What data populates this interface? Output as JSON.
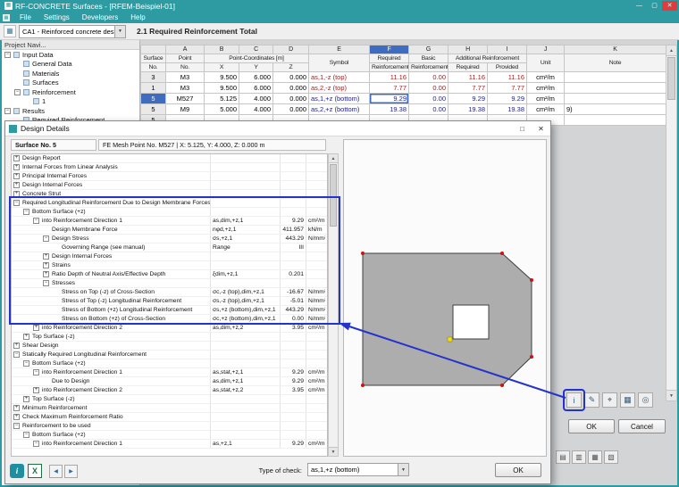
{
  "window": {
    "title": "RF-CONCRETE Surfaces - [RFEM-Beispiel-01]"
  },
  "menubar": {
    "items": [
      "File",
      "Settings",
      "Developers",
      "Help"
    ]
  },
  "toolbar": {
    "case_selector": "CA1 - Reinforced concrete desi",
    "table_title": "2.1 Required Reinforcement Total"
  },
  "icons": {
    "app": "▦",
    "menu_icon": "▦",
    "toolbar_table": "▦",
    "minimize": "—",
    "maximize": "▢",
    "close": "✕",
    "dropdown": "▼",
    "scroll_up": "▲",
    "scroll_down": "▼",
    "dialog_maximize": "□",
    "dialog_close": "✕",
    "info": "i",
    "excel": "X",
    "nav_prev": "◀",
    "nav_next": "▶"
  },
  "navigator": {
    "caption": "Project Navi...",
    "items": [
      {
        "label": "Input Data",
        "indent": 0,
        "expander": "minus"
      },
      {
        "label": "General Data",
        "indent": 1,
        "expander": "none"
      },
      {
        "label": "Materials",
        "indent": 1,
        "expander": "none"
      },
      {
        "label": "Surfaces",
        "indent": 1,
        "expander": "none"
      },
      {
        "label": "Reinforcement",
        "indent": 1,
        "expander": "minus"
      },
      {
        "label": "1",
        "indent": 2,
        "expander": "none"
      },
      {
        "label": "Results",
        "indent": 0,
        "expander": "minus"
      },
      {
        "label": "Required Reinforcement",
        "indent": 1,
        "expander": "none"
      }
    ]
  },
  "table": {
    "letters": [
      "",
      "A",
      "B",
      "C",
      "D",
      "E",
      "F",
      "G",
      "H",
      "I",
      "J",
      "K"
    ],
    "selected_letter": "F",
    "headers": {
      "surface": [
        "Surface",
        "No."
      ],
      "point": [
        "Point",
        "No."
      ],
      "coords_group": "Point-Coordinates [m]",
      "coords": [
        "X",
        "Y",
        "Z"
      ],
      "symbol": "Symbol",
      "required": [
        "Required",
        "Reinforcement"
      ],
      "basic": [
        "Basic",
        "Reinforcement"
      ],
      "additional_group": "Additional Reinforcement",
      "additional": [
        "Required",
        "Provided"
      ],
      "unit": "Unit",
      "note": "Note"
    },
    "rows": [
      {
        "surface": "3",
        "point": "M3",
        "x": "9.500",
        "y": "6.000",
        "z": "0.000",
        "symbol": "as,1,-z (top)",
        "required": "11.16",
        "basic": "0.00",
        "add_required": "11.16",
        "provided": "11.16",
        "unit": "cm²/m",
        "note": "",
        "side": "top",
        "selected": false
      },
      {
        "surface": "1",
        "point": "M3",
        "x": "9.500",
        "y": "6.000",
        "z": "0.000",
        "symbol": "as,2,-z (top)",
        "required": "7.77",
        "basic": "0.00",
        "add_required": "7.77",
        "provided": "7.77",
        "unit": "cm²/m",
        "note": "",
        "side": "top",
        "selected": false
      },
      {
        "surface": "5",
        "point": "M527",
        "x": "5.125",
        "y": "4.000",
        "z": "0.000",
        "symbol": "as,1,+z (bottom)",
        "required": "9.29",
        "basic": "0.00",
        "add_required": "9.29",
        "provided": "9.29",
        "unit": "cm²/m",
        "note": "",
        "side": "bottom",
        "selected": true
      },
      {
        "surface": "5",
        "point": "M9",
        "x": "5.000",
        "y": "4.000",
        "z": "0.000",
        "symbol": "as,2,+z (bottom)",
        "required": "19.38",
        "basic": "0.00",
        "add_required": "19.38",
        "provided": "19.38",
        "unit": "cm²/m",
        "note": "9)",
        "side": "bottom",
        "selected": false
      },
      {
        "surface": "5",
        "point": "",
        "x": "",
        "y": "",
        "z": "",
        "symbol": "",
        "required": "",
        "basic": "",
        "add_required": "",
        "provided": "",
        "unit": "",
        "note": "",
        "side": "",
        "selected": false
      }
    ]
  },
  "dialog": {
    "title": "Design Details",
    "surface_label": "Surface No. 5",
    "fe_point_info": "FE Mesh Point No. M527  |  X: 5.125, Y: 4.000, Z: 0.000 m",
    "rows": [
      {
        "indent": 0,
        "exp": "plus",
        "label": "Design Report",
        "symbol": "",
        "value": "",
        "unit": ""
      },
      {
        "indent": 0,
        "exp": "plus",
        "label": "Internal Forces from Linear Analysis",
        "symbol": "",
        "value": "",
        "unit": ""
      },
      {
        "indent": 0,
        "exp": "plus",
        "label": "Principal Internal Forces",
        "symbol": "",
        "value": "",
        "unit": ""
      },
      {
        "indent": 0,
        "exp": "plus",
        "label": "Design Internal Forces",
        "symbol": "",
        "value": "",
        "unit": ""
      },
      {
        "indent": 0,
        "exp": "plus",
        "label": "Concrete Strut",
        "symbol": "",
        "value": "",
        "unit": ""
      },
      {
        "indent": 0,
        "exp": "minus",
        "label": "Required Longitudinal Reinforcement Due to Design Membrane Forces",
        "symbol": "",
        "value": "",
        "unit": ""
      },
      {
        "indent": 1,
        "exp": "minus",
        "label": "Bottom Surface (+z)",
        "symbol": "",
        "value": "",
        "unit": ""
      },
      {
        "indent": 2,
        "exp": "minus",
        "label": "into Reinforcement Direction 1",
        "symbol": "as,dim,+z,1",
        "value": "9.29",
        "unit": "cm²/m"
      },
      {
        "indent": 3,
        "exp": "none",
        "label": "Design Membrane Force",
        "symbol": "nφd,+z,1",
        "value": "411.957",
        "unit": "kN/m"
      },
      {
        "indent": 3,
        "exp": "minus",
        "label": "Design Stress",
        "symbol": "σs,+z,1",
        "value": "443.29",
        "unit": "N/mm²"
      },
      {
        "indent": 4,
        "exp": "none",
        "label": "Governing Range (see manual)",
        "symbol": "Range",
        "value": "III",
        "unit": ""
      },
      {
        "indent": 3,
        "exp": "plus",
        "label": "Design Internal Forces",
        "symbol": "",
        "value": "",
        "unit": ""
      },
      {
        "indent": 3,
        "exp": "plus",
        "label": "Strains",
        "symbol": "",
        "value": "",
        "unit": ""
      },
      {
        "indent": 3,
        "exp": "plus",
        "label": "Ratio Depth of Neutral Axis/Effective Depth",
        "symbol": "ξdim,+z,1",
        "value": "0.201",
        "unit": ""
      },
      {
        "indent": 3,
        "exp": "minus",
        "label": "Stresses",
        "symbol": "",
        "value": "",
        "unit": ""
      },
      {
        "indent": 4,
        "exp": "none",
        "label": "Stress on Top (-z) of Cross-Section",
        "symbol": "σc,-z (top),dim,+z,1",
        "value": "-16.67",
        "unit": "N/mm²"
      },
      {
        "indent": 4,
        "exp": "none",
        "label": "Stress of Top (-z) Longitudinal Reinforcement",
        "symbol": "σs,-z (top),dim,+z,1",
        "value": "-5.01",
        "unit": "N/mm²"
      },
      {
        "indent": 4,
        "exp": "none",
        "label": "Stress of Bottom (+z) Longitudinal Reinforcement",
        "symbol": "σs,+z (bottom),dim,+z,1",
        "value": "443.29",
        "unit": "N/mm²"
      },
      {
        "indent": 4,
        "exp": "none",
        "label": "Stress on Bottom (+z) of Cross-Section",
        "symbol": "σc,+z (bottom),dim,+z,1",
        "value": "0.00",
        "unit": "N/mm²"
      },
      {
        "indent": 2,
        "exp": "plus",
        "label": "into Reinforcement Direction 2",
        "symbol": "as,dim,+z,2",
        "value": "3.95",
        "unit": "cm²/m"
      },
      {
        "indent": 1,
        "exp": "plus",
        "label": "Top Surface (-z)",
        "symbol": "",
        "value": "",
        "unit": ""
      },
      {
        "indent": 0,
        "exp": "plus",
        "label": "Shear Design",
        "symbol": "",
        "value": "",
        "unit": ""
      },
      {
        "indent": 0,
        "exp": "minus",
        "label": "Statically Required Longitudinal Reinforcement",
        "symbol": "",
        "value": "",
        "unit": ""
      },
      {
        "indent": 1,
        "exp": "minus",
        "label": "Bottom Surface (+z)",
        "symbol": "",
        "value": "",
        "unit": ""
      },
      {
        "indent": 2,
        "exp": "minus",
        "label": "into Reinforcement Direction 1",
        "symbol": "as,stat,+z,1",
        "value": "9.29",
        "unit": "cm²/m"
      },
      {
        "indent": 3,
        "exp": "none",
        "label": "Due to Design",
        "symbol": "as,dim,+z,1",
        "value": "9.29",
        "unit": "cm²/m"
      },
      {
        "indent": 2,
        "exp": "plus",
        "label": "into Reinforcement Direction 2",
        "symbol": "as,stat,+z,2",
        "value": "3.95",
        "unit": "cm²/m"
      },
      {
        "indent": 1,
        "exp": "plus",
        "label": "Top Surface (-z)",
        "symbol": "",
        "value": "",
        "unit": ""
      },
      {
        "indent": 0,
        "exp": "plus",
        "label": "Minimum Reinforcement",
        "symbol": "",
        "value": "",
        "unit": ""
      },
      {
        "indent": 0,
        "exp": "plus",
        "label": "Check Maximum Reinforcement Ratio",
        "symbol": "",
        "value": "",
        "unit": ""
      },
      {
        "indent": 0,
        "exp": "minus",
        "label": "Reinforcement to be used",
        "symbol": "",
        "value": "",
        "unit": ""
      },
      {
        "indent": 1,
        "exp": "minus",
        "label": "Bottom Surface (+z)",
        "symbol": "",
        "value": "",
        "unit": ""
      },
      {
        "indent": 2,
        "exp": "minus",
        "label": "into Reinforcement Direction 1",
        "symbol": "as,+z,1",
        "value": "9.29",
        "unit": "cm²/m"
      }
    ],
    "bottom": {
      "type_of_check_label": "Type of check:",
      "type_of_check_value": "as,1,+z (bottom)",
      "ok": "OK"
    }
  },
  "main_buttons": {
    "ok": "OK",
    "cancel": "Cancel"
  },
  "side_buttons": [
    {
      "name": "info",
      "glyph": "i"
    },
    {
      "name": "edit",
      "glyph": "✎"
    },
    {
      "name": "pick",
      "glyph": "⌖"
    },
    {
      "name": "grid",
      "glyph": "▦"
    },
    {
      "name": "view",
      "glyph": "◎"
    }
  ],
  "bottom_buttons": [
    {
      "name": "panel-1",
      "glyph": "▤"
    },
    {
      "name": "panel-2",
      "glyph": "▥"
    },
    {
      "name": "panel-3",
      "glyph": "▦"
    },
    {
      "name": "panel-4",
      "glyph": "▧"
    }
  ],
  "annotation": {
    "color": "#2433cc"
  }
}
